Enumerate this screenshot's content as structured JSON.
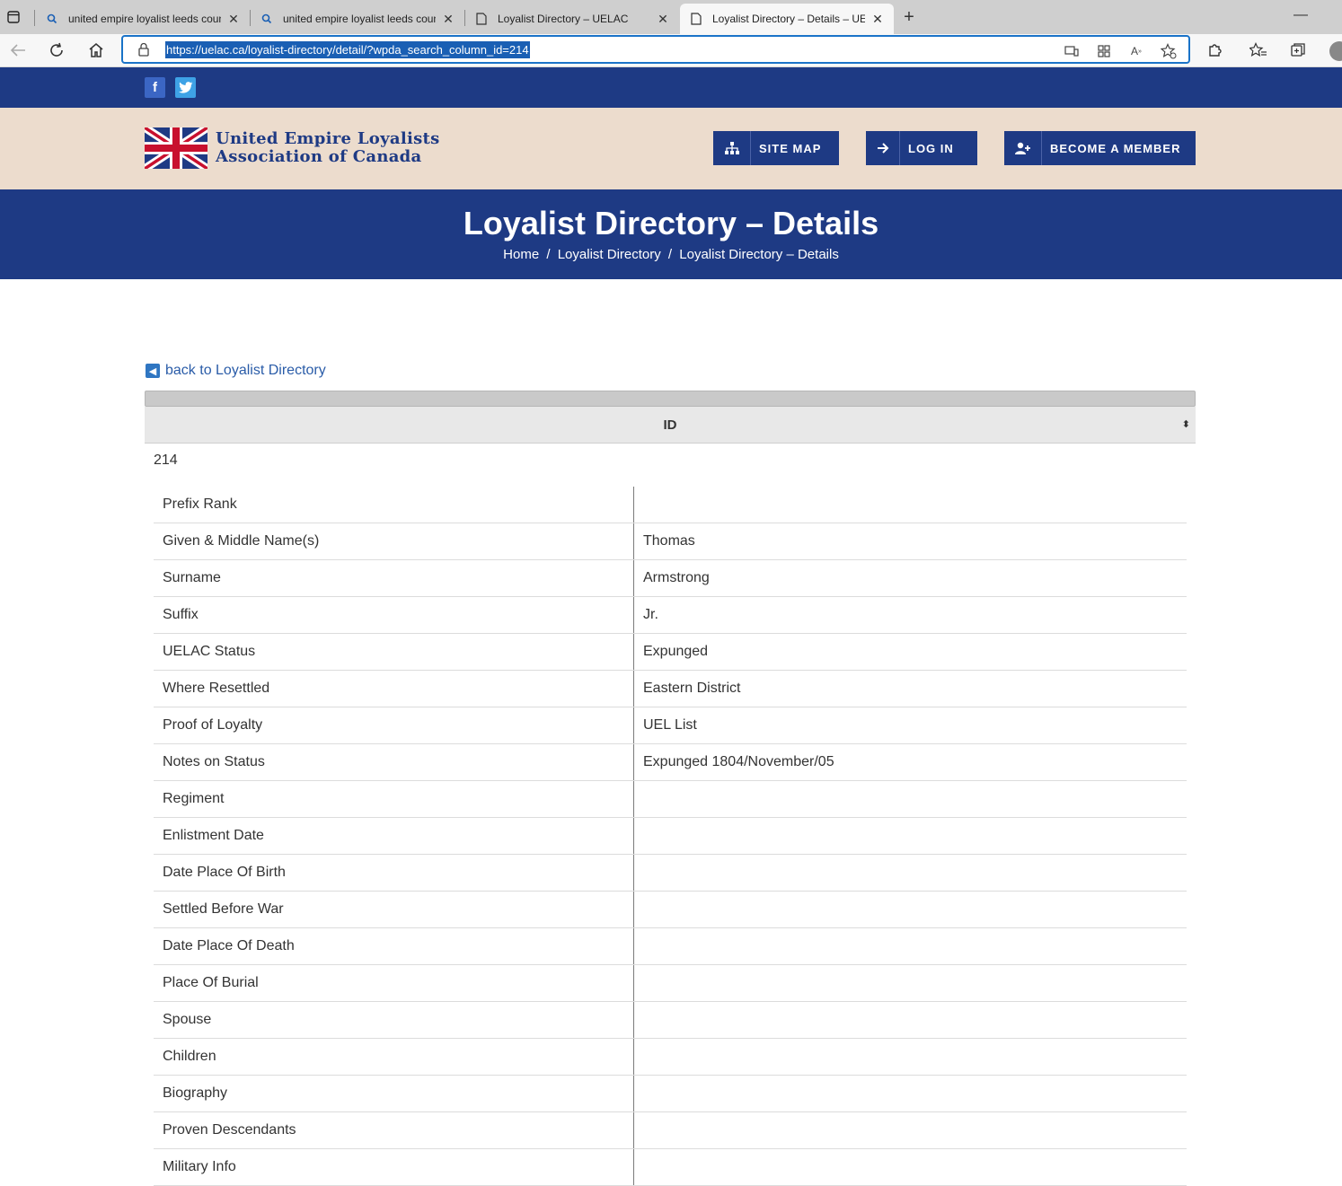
{
  "browser": {
    "tabs": [
      {
        "title": "united empire loyalist leeds coun",
        "icon": "search-icon"
      },
      {
        "title": "united empire loyalist leeds coun",
        "icon": "search-icon"
      },
      {
        "title": "Loyalist Directory – UELAC",
        "icon": "page-icon"
      },
      {
        "title": "Loyalist Directory – Details – UEL",
        "icon": "page-icon",
        "active": true
      }
    ],
    "url": "https://uelac.ca/loyalist-directory/detail/?wpda_search_column_id=214"
  },
  "site": {
    "logo_line1": "United Empire Loyalists",
    "logo_line2": "Association of Canada",
    "buttons": {
      "site_map": "SITE MAP",
      "log_in": "LOG IN",
      "become_member": "BECOME A MEMBER"
    },
    "social": {
      "facebook": "f",
      "twitter": "t"
    }
  },
  "banner": {
    "title": "Loyalist Directory – Details",
    "breadcrumb": [
      "Home",
      "/",
      "Loyalist Directory",
      "/",
      "Loyalist Directory – Details"
    ]
  },
  "content": {
    "back_link": "back to Loyalist Directory",
    "id_header": "ID",
    "id_value": "214",
    "rows": [
      {
        "label": "Prefix Rank",
        "value": ""
      },
      {
        "label": "Given & Middle Name(s)",
        "value": "Thomas"
      },
      {
        "label": "Surname",
        "value": "Armstrong"
      },
      {
        "label": "Suffix",
        "value": "Jr."
      },
      {
        "label": "UELAC Status",
        "value": "Expunged"
      },
      {
        "label": "Where Resettled",
        "value": "Eastern District"
      },
      {
        "label": "Proof of Loyalty",
        "value": "UEL List"
      },
      {
        "label": "Notes on Status",
        "value": "Expunged 1804/November/05"
      },
      {
        "label": "Regiment",
        "value": ""
      },
      {
        "label": "Enlistment Date",
        "value": ""
      },
      {
        "label": "Date Place Of Birth",
        "value": ""
      },
      {
        "label": "Settled Before War",
        "value": ""
      },
      {
        "label": "Date Place Of Death",
        "value": ""
      },
      {
        "label": "Place Of Burial",
        "value": ""
      },
      {
        "label": "Spouse",
        "value": ""
      },
      {
        "label": "Children",
        "value": ""
      },
      {
        "label": "Biography",
        "value": ""
      },
      {
        "label": "Proven Descendants",
        "value": ""
      },
      {
        "label": "Military Info",
        "value": ""
      }
    ]
  },
  "colors": {
    "brand_blue": "#1e3a84",
    "header_beige": "#ecdccd",
    "link_blue": "#2a5ca8"
  }
}
